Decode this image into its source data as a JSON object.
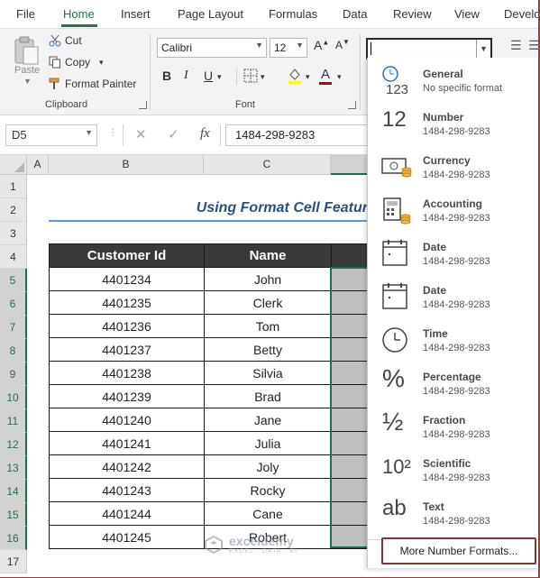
{
  "ribbon": {
    "tabs": [
      "File",
      "Home",
      "Insert",
      "Page Layout",
      "Formulas",
      "Data",
      "Review",
      "View",
      "Develo"
    ],
    "active_tab": "Home",
    "clipboard": {
      "paste_label": "Paste",
      "cut_label": "Cut",
      "copy_label": "Copy",
      "format_painter_label": "Format Painter",
      "group_label": "Clipboard"
    },
    "font": {
      "family": "Calibri",
      "size": "12",
      "bold": "B",
      "italic": "I",
      "underline": "U",
      "group_label": "Font"
    },
    "number_format_value": ""
  },
  "formula_bar": {
    "name_box": "D5",
    "fx": "fx",
    "cancel": "✕",
    "enter": "✓",
    "formula": "1484-298-9283"
  },
  "grid": {
    "columns": [
      "A",
      "B",
      "C"
    ],
    "rows": [
      "1",
      "2",
      "3",
      "4",
      "5",
      "6",
      "7",
      "8",
      "9",
      "10",
      "11",
      "12",
      "13",
      "14",
      "15",
      "16",
      "17"
    ],
    "title": "Using Format Cell Featur",
    "headers": [
      "Customer Id",
      "Name"
    ],
    "records": [
      {
        "id": "4401234",
        "name": "John"
      },
      {
        "id": "4401235",
        "name": "Clerk"
      },
      {
        "id": "4401236",
        "name": "Tom"
      },
      {
        "id": "4401237",
        "name": "Betty"
      },
      {
        "id": "4401238",
        "name": "Silvia"
      },
      {
        "id": "4401239",
        "name": "Brad"
      },
      {
        "id": "4401240",
        "name": "Jane"
      },
      {
        "id": "4401241",
        "name": "Julia"
      },
      {
        "id": "4401242",
        "name": "Joly"
      },
      {
        "id": "4401243",
        "name": "Rocky"
      },
      {
        "id": "4401244",
        "name": "Cane"
      },
      {
        "id": "4401245",
        "name": "Robert"
      }
    ]
  },
  "watermark": {
    "name": "exceldemy",
    "tagline": "EXCEL · DATA · BI"
  },
  "number_format_menu": {
    "items": [
      {
        "name": "General",
        "sample": "No specific format",
        "icon": "clock-123-icon"
      },
      {
        "name": "Number",
        "sample": "1484-298-9283",
        "icon": "number-12-icon",
        "glyph": "12"
      },
      {
        "name": "Currency",
        "sample": "1484-298-9283",
        "icon": "currency-icon"
      },
      {
        "name": "Accounting",
        "sample": "1484-298-9283",
        "icon": "accounting-icon"
      },
      {
        "name": "Date",
        "sample": "1484-298-9283",
        "icon": "calendar-icon"
      },
      {
        "name": "Date",
        "sample": "1484-298-9283",
        "icon": "calendar-icon"
      },
      {
        "name": "Time",
        "sample": "1484-298-9283",
        "icon": "clock-icon"
      },
      {
        "name": "Percentage",
        "sample": "1484-298-9283",
        "icon": "percent-icon",
        "glyph": "%"
      },
      {
        "name": "Fraction",
        "sample": "1484-298-9283",
        "icon": "fraction-icon",
        "glyph": "½"
      },
      {
        "name": "Scientific",
        "sample": "1484-298-9283",
        "icon": "scientific-icon",
        "glyph": "10²"
      },
      {
        "name": "Text",
        "sample": "1484-298-9283",
        "icon": "text-ab-icon",
        "glyph": "ab"
      }
    ],
    "more_label": "More Number Formats..."
  }
}
